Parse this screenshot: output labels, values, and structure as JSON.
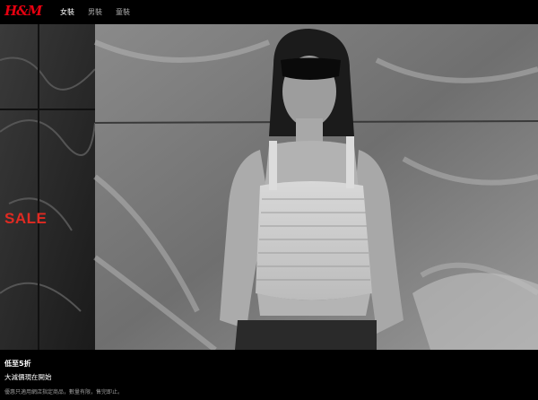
{
  "brand": {
    "logo": "H&M",
    "brand_color": "#e50010"
  },
  "nav": {
    "items": [
      {
        "label": "女裝",
        "active": true
      },
      {
        "label": "男裝",
        "active": false
      },
      {
        "label": "童裝",
        "active": false
      }
    ]
  },
  "hero": {
    "sale_label": "SALE",
    "sale_color": "#e02a22",
    "image_description": "black-and-white model with sunglasses against marble wall"
  },
  "promo": {
    "title": "低至5折",
    "subtitle": "大減價現在開始",
    "note": "優惠只適用網店指定商品，數量有限，售完即止。"
  }
}
